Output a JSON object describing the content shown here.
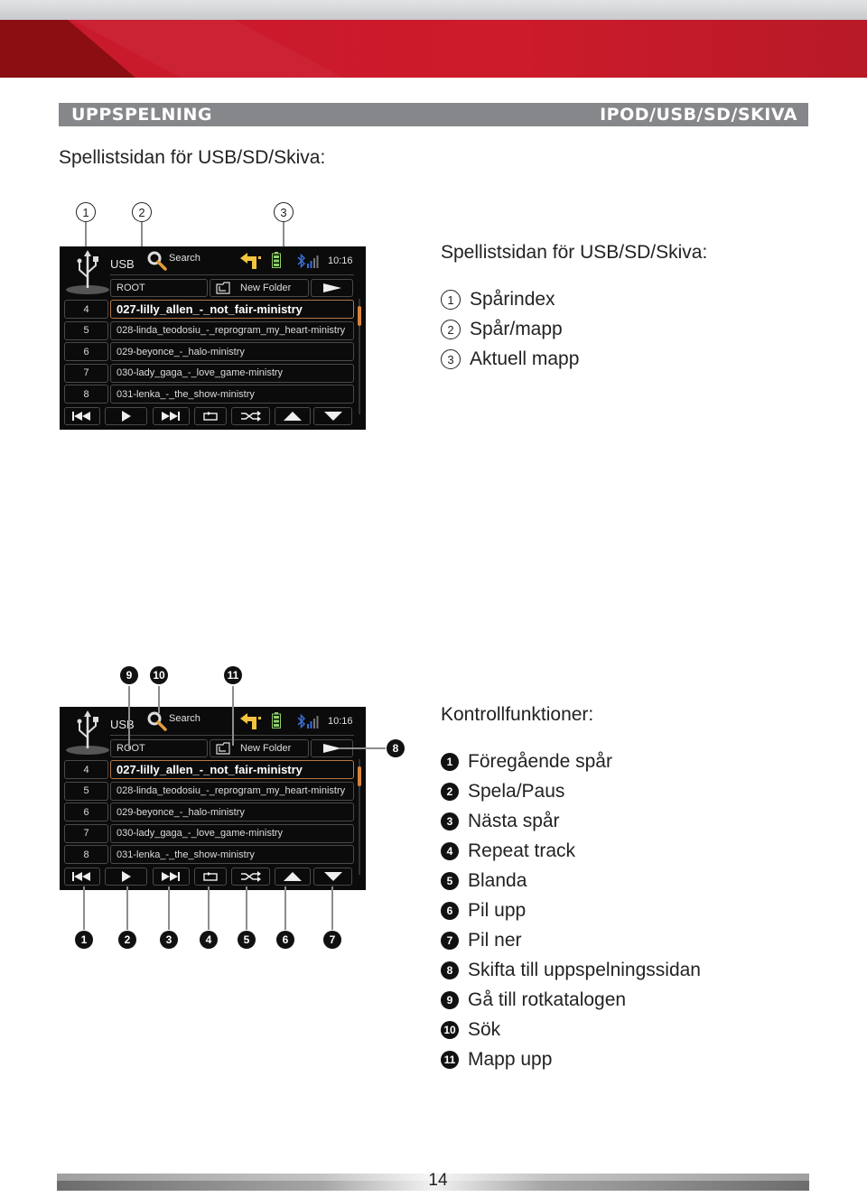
{
  "header": {
    "section_left": "UPPSPELNING",
    "section_right": "IPOD/USB/SD/SKIVA",
    "subtitle": "Spellistsidan för USB/SD/Skiva:"
  },
  "colors": {
    "brand_red": "#c81a2c",
    "section_bar": "#86878a",
    "screen_bg": "#0b0b0b",
    "selected_border": "#b57646"
  },
  "screen": {
    "source_label": "USB",
    "search_label": "Search",
    "clock": "10:16",
    "root_label": "ROOT",
    "folder_label": "New Folder",
    "tracks": [
      {
        "index": "4",
        "name": "027-lilly_allen_-_not_fair-ministry",
        "selected": true
      },
      {
        "index": "5",
        "name": "028-linda_teodosiu_-_reprogram_my_heart-ministry",
        "selected": false
      },
      {
        "index": "6",
        "name": "029-beyonce_-_halo-ministry",
        "selected": false
      },
      {
        "index": "7",
        "name": "030-lady_gaga_-_love_game-ministry",
        "selected": false
      },
      {
        "index": "8",
        "name": "031-lenka_-_the_show-ministry",
        "selected": false
      }
    ],
    "controls": [
      "previous-track-icon",
      "play-icon",
      "next-track-icon",
      "repeat-icon",
      "shuffle-icon",
      "arrow-up-icon",
      "arrow-down-icon"
    ]
  },
  "playlist_section": {
    "title": "Spellistsidan för USB/SD/Skiva:",
    "callouts": [
      "1",
      "2",
      "3"
    ],
    "items": [
      {
        "num": "1",
        "label": "Spårindex"
      },
      {
        "num": "2",
        "label": "Spår/mapp"
      },
      {
        "num": "3",
        "label": "Aktuell mapp"
      }
    ]
  },
  "control_section": {
    "title": "Kontrollfunktioner:",
    "top_callouts": [
      "9",
      "10",
      "11"
    ],
    "side_callout": "8",
    "bottom_callouts": [
      "1",
      "2",
      "3",
      "4",
      "5",
      "6",
      "7"
    ],
    "items": [
      {
        "num": "1",
        "label": "Föregående spår"
      },
      {
        "num": "2",
        "label": "Spela/Paus"
      },
      {
        "num": "3",
        "label": "Nästa spår"
      },
      {
        "num": "4",
        "label": "Repeat track"
      },
      {
        "num": "5",
        "label": "Blanda"
      },
      {
        "num": "6",
        "label": "Pil upp"
      },
      {
        "num": "7",
        "label": "Pil ner"
      },
      {
        "num": "8",
        "label": "Skifta till uppspelningssidan"
      },
      {
        "num": "9",
        "label": "Gå till rotkatalogen"
      },
      {
        "num": "10",
        "label": "Sök"
      },
      {
        "num": "11",
        "label": "Mapp upp"
      }
    ]
  },
  "footer": {
    "page_number": "14"
  }
}
